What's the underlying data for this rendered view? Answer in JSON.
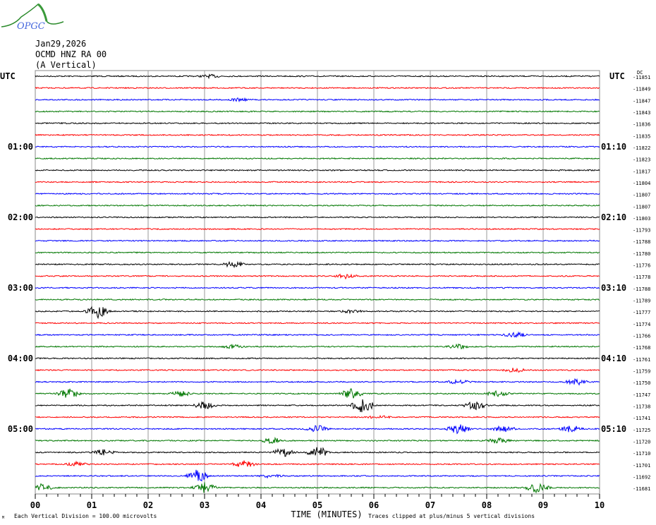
{
  "header": {
    "logo_text": "OPGC",
    "date": "Jan29,2026",
    "station": "OCMD HNZ RA 00",
    "component": "(A Vertical)"
  },
  "chart_data": {
    "type": "line",
    "title": "Jan29,2026 OCMD HNZ RA 00 (A Vertical)",
    "xlabel": "TIME (MINUTES)",
    "xlim": [
      0,
      10
    ],
    "x_ticks": [
      "00",
      "01",
      "02",
      "03",
      "04",
      "05",
      "06",
      "07",
      "08",
      "09",
      "10"
    ],
    "left_axis_title": "UTC",
    "right_axis_title": "UTC",
    "dc_label": "DC",
    "left_hour_labels": [
      {
        "row": 0,
        "label": "UTC"
      },
      {
        "row": 6,
        "label": "01:00"
      },
      {
        "row": 12,
        "label": "02:00"
      },
      {
        "row": 18,
        "label": "03:00"
      },
      {
        "row": 24,
        "label": "04:00"
      },
      {
        "row": 30,
        "label": "05:00"
      }
    ],
    "right_hour_labels": [
      {
        "row": 0,
        "label": "UTC"
      },
      {
        "row": 6,
        "label": "01:10"
      },
      {
        "row": 12,
        "label": "02:10"
      },
      {
        "row": 18,
        "label": "03:10"
      },
      {
        "row": 24,
        "label": "04:10"
      },
      {
        "row": 30,
        "label": "05:10"
      }
    ],
    "trace_colors": [
      "#000000",
      "#ff0000",
      "#0000ff",
      "#007700"
    ],
    "dc_offsets": [
      "-11851",
      "-11849",
      "-11847",
      "-11843",
      "-11836",
      "-11835",
      "-11822",
      "-11823",
      "-11817",
      "-11804",
      "-11807",
      "-11807",
      "-11803",
      "-11793",
      "-11788",
      "-11780",
      "-11776",
      "-11778",
      "-11788",
      "-11789",
      "-11777",
      "-11774",
      "-11766",
      "-11768",
      "-11761",
      "-11759",
      "-11750",
      "-11747",
      "-11738",
      "-11741",
      "-11725",
      "-11720",
      "-11710",
      "-11701",
      "-11692",
      "-11681"
    ],
    "events": [
      {
        "row": 0,
        "minute": 3.1,
        "amp": 2
      },
      {
        "row": 2,
        "minute": 3.6,
        "amp": 2
      },
      {
        "row": 16,
        "minute": 3.5,
        "amp": 4
      },
      {
        "row": 17,
        "minute": 5.5,
        "amp": 3
      },
      {
        "row": 20,
        "minute": 1.1,
        "amp": 10
      },
      {
        "row": 20,
        "minute": 5.6,
        "amp": 2
      },
      {
        "row": 22,
        "minute": 8.5,
        "amp": 4
      },
      {
        "row": 23,
        "minute": 3.5,
        "amp": 3
      },
      {
        "row": 23,
        "minute": 7.5,
        "amp": 3
      },
      {
        "row": 25,
        "minute": 8.5,
        "amp": 3
      },
      {
        "row": 26,
        "minute": 7.5,
        "amp": 3
      },
      {
        "row": 26,
        "minute": 9.6,
        "amp": 5
      },
      {
        "row": 27,
        "minute": 0.6,
        "amp": 7
      },
      {
        "row": 27,
        "minute": 2.6,
        "amp": 4
      },
      {
        "row": 27,
        "minute": 5.6,
        "amp": 7
      },
      {
        "row": 27,
        "minute": 8.2,
        "amp": 4
      },
      {
        "row": 28,
        "minute": 3.0,
        "amp": 5
      },
      {
        "row": 28,
        "minute": 5.8,
        "amp": 11
      },
      {
        "row": 28,
        "minute": 7.8,
        "amp": 6
      },
      {
        "row": 29,
        "minute": 6.1,
        "amp": 2
      },
      {
        "row": 30,
        "minute": 5.0,
        "amp": 5
      },
      {
        "row": 30,
        "minute": 7.5,
        "amp": 7
      },
      {
        "row": 30,
        "minute": 8.3,
        "amp": 5
      },
      {
        "row": 30,
        "minute": 9.5,
        "amp": 5
      },
      {
        "row": 31,
        "minute": 4.2,
        "amp": 4
      },
      {
        "row": 31,
        "minute": 8.2,
        "amp": 4
      },
      {
        "row": 32,
        "minute": 1.2,
        "amp": 4
      },
      {
        "row": 32,
        "minute": 4.4,
        "amp": 6
      },
      {
        "row": 32,
        "minute": 5.0,
        "amp": 9
      },
      {
        "row": 33,
        "minute": 0.75,
        "amp": 3
      },
      {
        "row": 33,
        "minute": 3.7,
        "amp": 5
      },
      {
        "row": 34,
        "minute": 2.9,
        "amp": 10
      },
      {
        "row": 34,
        "minute": 4.2,
        "amp": 3
      },
      {
        "row": 35,
        "minute": 3.0,
        "amp": 8
      },
      {
        "row": 35,
        "minute": 0.1,
        "amp": 5
      },
      {
        "row": 35,
        "minute": 8.9,
        "amp": 8
      }
    ]
  },
  "footer": {
    "scale_note": "Each Vertical Division =  100.00 microvolts",
    "clip_note": "Traces clipped at plus/minus 5 vertical divisions",
    "corner_mark": "M"
  }
}
